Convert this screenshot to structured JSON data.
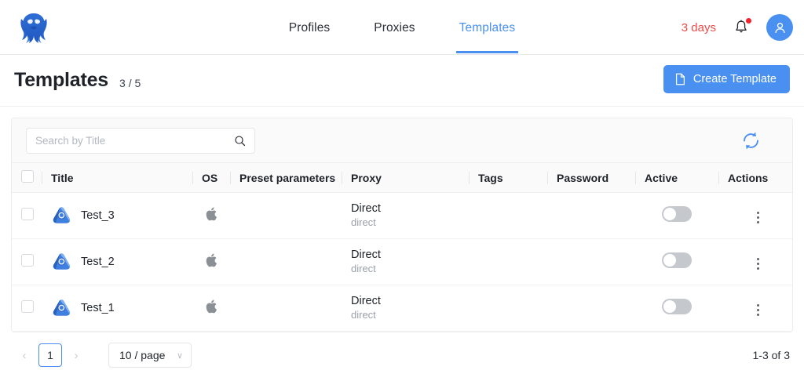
{
  "brand": {
    "logo_icon": "octopus-logo-icon",
    "accent_color": "#4a90f0",
    "warning_color": "#f04a4a"
  },
  "nav": {
    "tabs": [
      {
        "label": "Profiles",
        "active": false
      },
      {
        "label": "Proxies",
        "active": false
      },
      {
        "label": "Templates",
        "active": true
      }
    ],
    "trial_label": "3 days",
    "bell_icon": "notification-bell-icon",
    "bell_has_badge": true,
    "avatar_icon": "user-avatar-icon"
  },
  "page": {
    "title": "Templates",
    "count": "3 / 5",
    "create_button": {
      "label": "Create Template",
      "icon": "file-plus-icon"
    }
  },
  "toolbar": {
    "search": {
      "placeholder": "Search by Title",
      "value": "",
      "icon": "search-icon"
    },
    "refresh_icon": "refresh-sync-icon"
  },
  "table": {
    "columns": [
      {
        "key": "check",
        "label": ""
      },
      {
        "key": "title",
        "label": "Title"
      },
      {
        "key": "os",
        "label": "OS"
      },
      {
        "key": "preset",
        "label": "Preset parameters"
      },
      {
        "key": "proxy",
        "label": "Proxy"
      },
      {
        "key": "tags",
        "label": "Tags"
      },
      {
        "key": "password",
        "label": "Password"
      },
      {
        "key": "active",
        "label": "Active"
      },
      {
        "key": "actions",
        "label": "Actions"
      }
    ],
    "rows": [
      {
        "title": "Test_3",
        "icon": "template-shield-icon",
        "os": "apple-icon",
        "preset": "",
        "proxy_main": "Direct",
        "proxy_sub": "direct",
        "tags": "",
        "password": "",
        "active": false,
        "actions_icon": "more-vertical-icon"
      },
      {
        "title": "Test_2",
        "icon": "template-shield-icon",
        "os": "apple-icon",
        "preset": "",
        "proxy_main": "Direct",
        "proxy_sub": "direct",
        "tags": "",
        "password": "",
        "active": false,
        "actions_icon": "more-vertical-icon"
      },
      {
        "title": "Test_1",
        "icon": "template-shield-icon",
        "os": "apple-icon",
        "preset": "",
        "proxy_main": "Direct",
        "proxy_sub": "direct",
        "tags": "",
        "password": "",
        "active": false,
        "actions_icon": "more-vertical-icon"
      }
    ]
  },
  "pagination": {
    "prev_label": "‹",
    "next_label": "›",
    "current_page": "1",
    "page_size": "10 / page",
    "page_size_caret": "∨",
    "range_label": "1-3 of 3"
  }
}
